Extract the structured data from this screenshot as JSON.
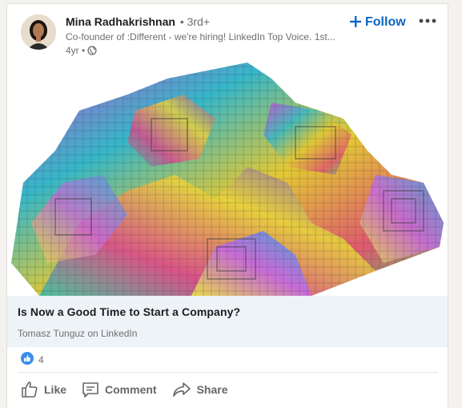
{
  "author": {
    "name": "Mina Radhakrishnan",
    "degree": "• 3rd+",
    "headline": "Co-founder of :Different - we're hiring! LinkedIn Top Voice. 1st...",
    "age": "4yr •"
  },
  "header": {
    "follow_label": "Follow",
    "follow_icon": "plus-icon",
    "more_icon": "ellipsis-icon"
  },
  "article": {
    "title": "Is Now a Good Time to Start a Company?",
    "source": "Tomasz Tunguz on LinkedIn"
  },
  "social": {
    "reaction_icon": "like-reaction-icon",
    "reaction_count": "4"
  },
  "actions": {
    "like": "Like",
    "comment": "Comment",
    "share": "Share"
  },
  "colors": {
    "accent": "#0a66c2",
    "text": "#1d1d1d",
    "muted": "#6f6f6f",
    "link_bg": "#eef3f8"
  }
}
